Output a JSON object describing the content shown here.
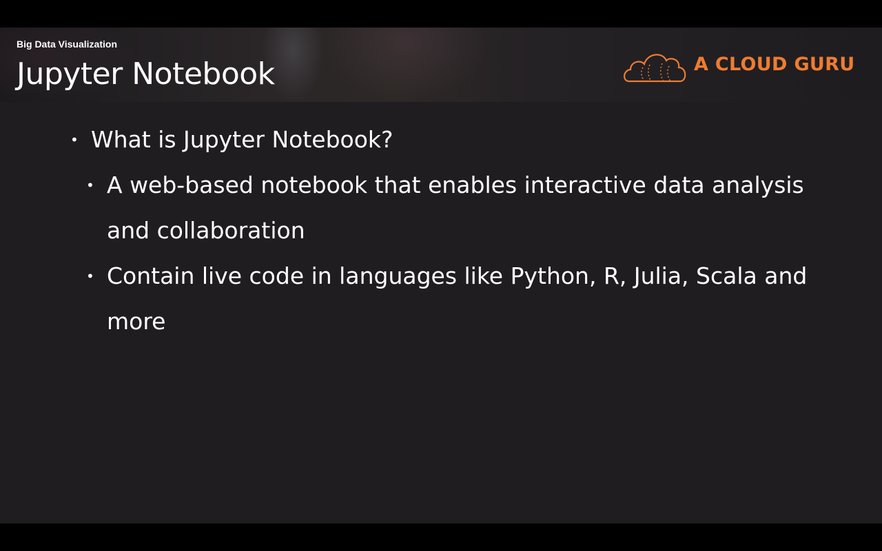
{
  "header": {
    "subtitle": "Big Data Visualization",
    "title": "Jupyter Notebook",
    "logo_text": "A CLOUD GURU",
    "logo_icon": "cloud-logo-icon",
    "brand_color": "#ef7c31"
  },
  "bullets": [
    {
      "level": 1,
      "text": "What is Jupyter Notebook?"
    },
    {
      "level": 2,
      "text": "A web-based notebook that enables interactive data analysis and collaboration"
    },
    {
      "level": 2,
      "text": "Contain live code in languages like Python, R, Julia, Scala and more"
    }
  ],
  "bullet_glyph": "•",
  "colors": {
    "background": "#1f1d20",
    "text": "#ffffff"
  }
}
